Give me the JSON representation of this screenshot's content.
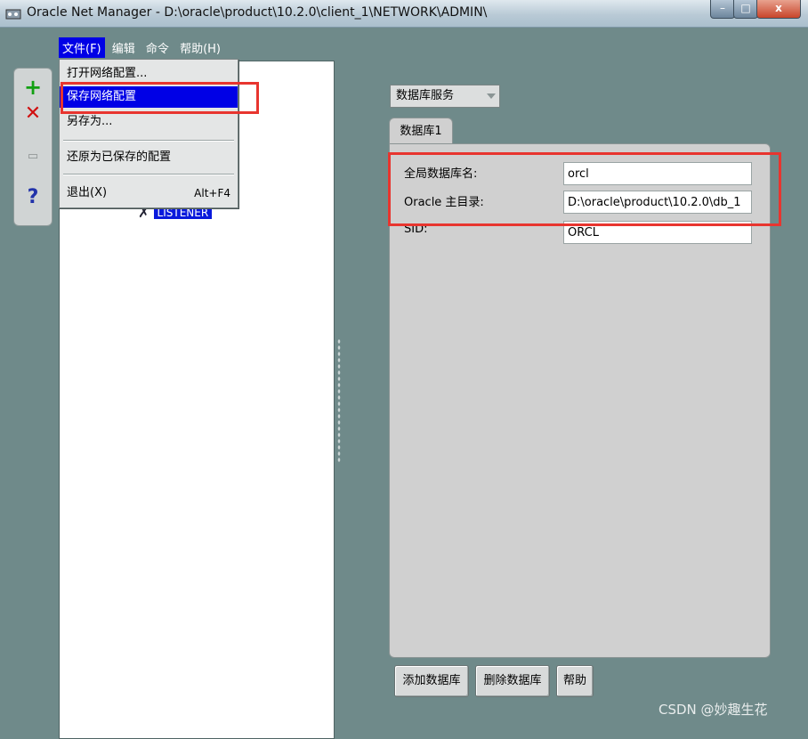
{
  "window": {
    "title": "Oracle Net Manager - D:\\oracle\\product\\10.2.0\\client_1\\NETWORK\\ADMIN\\",
    "buttons": {
      "minimize": "–",
      "maximize": "□",
      "close": "x"
    }
  },
  "menubar": {
    "items": [
      {
        "label": "文件(F)",
        "open": true
      },
      {
        "label": "编辑"
      },
      {
        "label": "命令"
      },
      {
        "label": "帮助(H)"
      }
    ]
  },
  "file_menu": {
    "items": [
      {
        "label": "打开网络配置..."
      },
      {
        "label": "保存网络配置",
        "selected": true
      },
      {
        "label": "另存为..."
      },
      {
        "label": "还原为已保存的配置"
      },
      {
        "label": "退出(X)",
        "shortcut": "Alt+F4"
      }
    ]
  },
  "toolbar": {
    "add": {
      "glyph": "+",
      "icon": "add-icon"
    },
    "remove": {
      "glyph": "✕",
      "icon": "remove-icon"
    },
    "test": {
      "glyph": "▭",
      "icon": "test-icon"
    },
    "help": {
      "glyph": "?",
      "icon": "help-icon"
    }
  },
  "tree": {
    "nodes": [
      {
        "label": "LISTENER",
        "selected": true,
        "icon": "listener-icon"
      }
    ]
  },
  "service_select": {
    "value": "数据库服务"
  },
  "tabs": [
    {
      "label": "数据库1",
      "active": true
    }
  ],
  "database_form": {
    "global_db_name": {
      "label": "全局数据库名:",
      "value": "orcl"
    },
    "oracle_home": {
      "label": "Oracle 主目录:",
      "value": "D:\\oracle\\product\\10.2.0\\db_1"
    },
    "sid": {
      "label": "SID:",
      "value": "ORCL"
    }
  },
  "buttons": {
    "add_database": "添加数据库",
    "remove_database": "删除数据库",
    "help": "帮助"
  },
  "watermark": "CSDN @妙趣生花",
  "colors": {
    "background": "#6f8a8a",
    "menu_highlight": "#0000e6",
    "annotation_red": "#e8352f",
    "panel": "#d0d0d0"
  }
}
